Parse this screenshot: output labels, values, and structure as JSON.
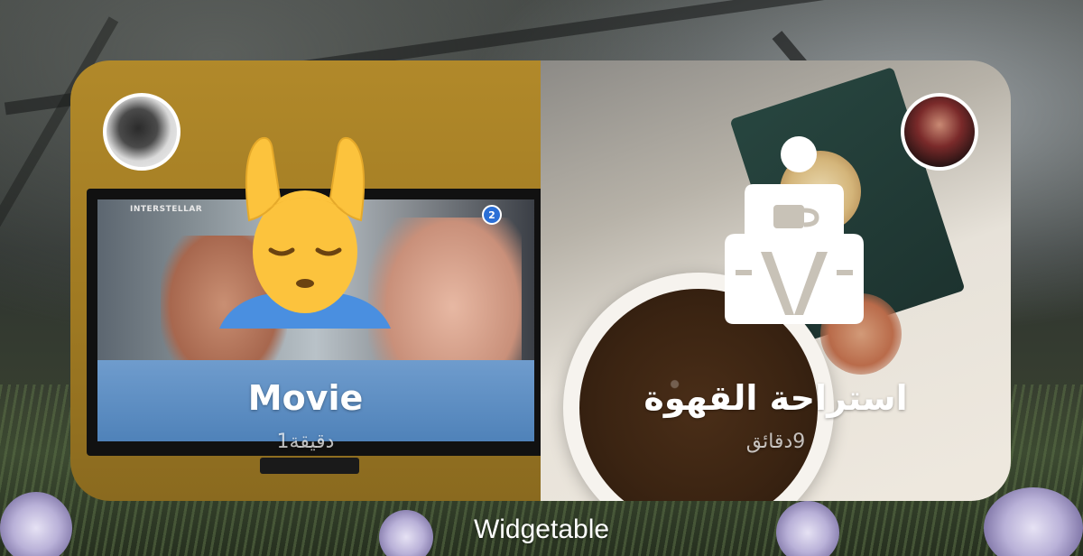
{
  "widget": {
    "panels": [
      {
        "title": "Movie",
        "duration": "1دقيقة",
        "icon": "person-getting-massage-emoji",
        "background": "tv-photo",
        "avatar": "user-avatar"
      },
      {
        "title": "استراحة القهوة",
        "duration": "9دقائق",
        "icon": "coffee-break-pictogram-icon",
        "background": "coffee-photo",
        "avatar": "user-avatar"
      }
    ]
  },
  "tv": {
    "channel_label": "INTERSTELLAR",
    "badge": "2"
  },
  "app_caption": "Widgetable",
  "colors": {
    "left_panel": "#a67f25",
    "right_panel": "#efe9df",
    "text": "#ffffff"
  }
}
